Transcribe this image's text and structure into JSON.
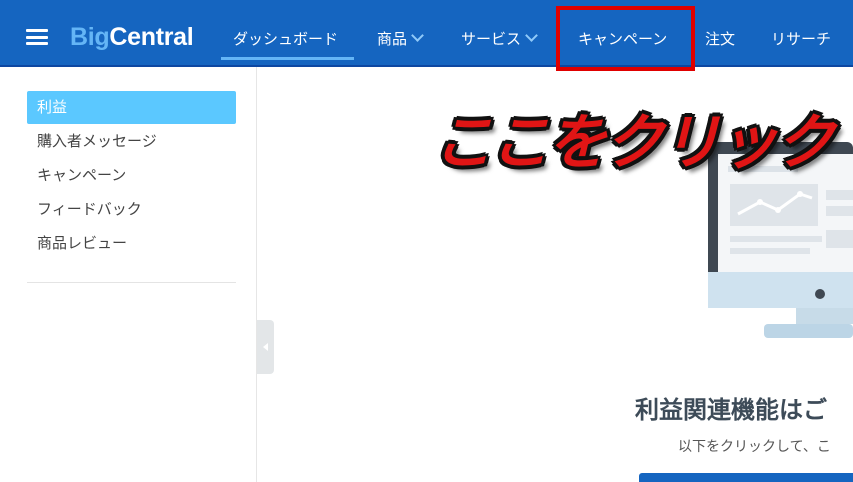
{
  "app": {
    "logo_part1": "Big",
    "logo_part2": "Central"
  },
  "nav": {
    "items": [
      {
        "label": "ダッシュボード",
        "active": true
      },
      {
        "label": "商品",
        "has_dropdown": true
      },
      {
        "label": "サービス",
        "has_dropdown": true
      },
      {
        "label": "キャンペーン",
        "highlighted": true
      },
      {
        "label": "注文"
      },
      {
        "label": "リサーチ"
      }
    ]
  },
  "sidebar": {
    "items": [
      {
        "label": "利益",
        "active": true
      },
      {
        "label": "購入者メッセージ"
      },
      {
        "label": "キャンペーン"
      },
      {
        "label": "フィードバック"
      },
      {
        "label": "商品レビュー"
      }
    ]
  },
  "annotation": {
    "text": "ここをクリック",
    "color": "#e01515"
  },
  "main": {
    "heading": "利益関連機能はご",
    "subtext": "以下をクリックして、こ"
  },
  "colors": {
    "topbar": "#1565c0",
    "sidebar_active": "#5bc8ff",
    "highlight_box": "#e00000"
  },
  "icons": {
    "menu": "hamburger-menu-icon",
    "collapse": "collapse-sidebar-icon"
  }
}
